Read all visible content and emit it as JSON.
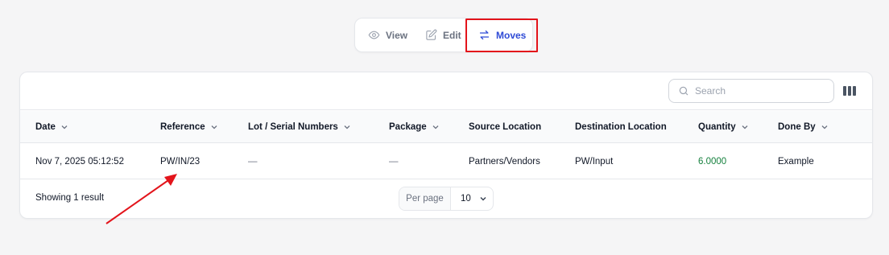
{
  "tabs": [
    {
      "label": "View",
      "icon": "eye-icon",
      "active": false
    },
    {
      "label": "Edit",
      "icon": "edit-icon",
      "active": false
    },
    {
      "label": "Moves",
      "icon": "arrows-swap-icon",
      "active": true
    }
  ],
  "toolbar": {
    "search_placeholder": "Search",
    "columns_icon": "columns-icon"
  },
  "table": {
    "headers": [
      {
        "label": "Date",
        "sortable": true
      },
      {
        "label": "Reference",
        "sortable": true
      },
      {
        "label": "Lot / Serial Numbers",
        "sortable": true
      },
      {
        "label": "Package",
        "sortable": true
      },
      {
        "label": "Source Location",
        "sortable": false
      },
      {
        "label": "Destination Location",
        "sortable": false
      },
      {
        "label": "Quantity",
        "sortable": true
      },
      {
        "label": "Done By",
        "sortable": true
      }
    ],
    "rows": [
      [
        "Nov 7, 2025 05:12:52",
        "PW/IN/23",
        "—",
        "—",
        "Partners/Vendors",
        "PW/Input",
        "6.0000",
        "Example"
      ]
    ]
  },
  "footer": {
    "summary": "Showing 1 result",
    "per_page_label": "Per page",
    "per_page_value": "10"
  },
  "colors": {
    "accent": "#2f4bd6",
    "highlight": "#e3141b",
    "quantity": "#15803d"
  }
}
